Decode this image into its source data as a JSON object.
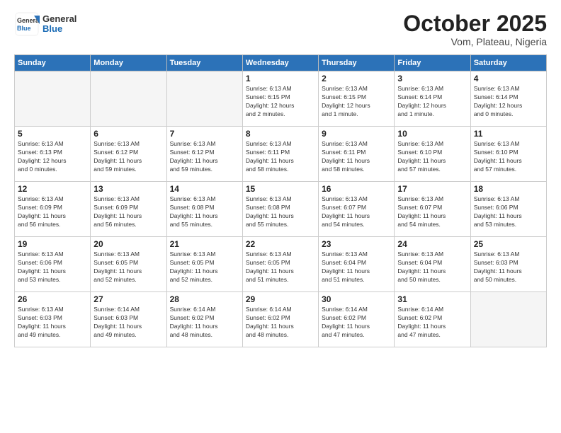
{
  "logo": {
    "text_general": "General",
    "text_blue": "Blue"
  },
  "header": {
    "month": "October 2025",
    "location": "Vom, Plateau, Nigeria"
  },
  "weekdays": [
    "Sunday",
    "Monday",
    "Tuesday",
    "Wednesday",
    "Thursday",
    "Friday",
    "Saturday"
  ],
  "weeks": [
    [
      {
        "day": "",
        "info": ""
      },
      {
        "day": "",
        "info": ""
      },
      {
        "day": "",
        "info": ""
      },
      {
        "day": "1",
        "info": "Sunrise: 6:13 AM\nSunset: 6:15 PM\nDaylight: 12 hours\nand 2 minutes."
      },
      {
        "day": "2",
        "info": "Sunrise: 6:13 AM\nSunset: 6:15 PM\nDaylight: 12 hours\nand 1 minute."
      },
      {
        "day": "3",
        "info": "Sunrise: 6:13 AM\nSunset: 6:14 PM\nDaylight: 12 hours\nand 1 minute."
      },
      {
        "day": "4",
        "info": "Sunrise: 6:13 AM\nSunset: 6:14 PM\nDaylight: 12 hours\nand 0 minutes."
      }
    ],
    [
      {
        "day": "5",
        "info": "Sunrise: 6:13 AM\nSunset: 6:13 PM\nDaylight: 12 hours\nand 0 minutes."
      },
      {
        "day": "6",
        "info": "Sunrise: 6:13 AM\nSunset: 6:12 PM\nDaylight: 11 hours\nand 59 minutes."
      },
      {
        "day": "7",
        "info": "Sunrise: 6:13 AM\nSunset: 6:12 PM\nDaylight: 11 hours\nand 59 minutes."
      },
      {
        "day": "8",
        "info": "Sunrise: 6:13 AM\nSunset: 6:11 PM\nDaylight: 11 hours\nand 58 minutes."
      },
      {
        "day": "9",
        "info": "Sunrise: 6:13 AM\nSunset: 6:11 PM\nDaylight: 11 hours\nand 58 minutes."
      },
      {
        "day": "10",
        "info": "Sunrise: 6:13 AM\nSunset: 6:10 PM\nDaylight: 11 hours\nand 57 minutes."
      },
      {
        "day": "11",
        "info": "Sunrise: 6:13 AM\nSunset: 6:10 PM\nDaylight: 11 hours\nand 57 minutes."
      }
    ],
    [
      {
        "day": "12",
        "info": "Sunrise: 6:13 AM\nSunset: 6:09 PM\nDaylight: 11 hours\nand 56 minutes."
      },
      {
        "day": "13",
        "info": "Sunrise: 6:13 AM\nSunset: 6:09 PM\nDaylight: 11 hours\nand 56 minutes."
      },
      {
        "day": "14",
        "info": "Sunrise: 6:13 AM\nSunset: 6:08 PM\nDaylight: 11 hours\nand 55 minutes."
      },
      {
        "day": "15",
        "info": "Sunrise: 6:13 AM\nSunset: 6:08 PM\nDaylight: 11 hours\nand 55 minutes."
      },
      {
        "day": "16",
        "info": "Sunrise: 6:13 AM\nSunset: 6:07 PM\nDaylight: 11 hours\nand 54 minutes."
      },
      {
        "day": "17",
        "info": "Sunrise: 6:13 AM\nSunset: 6:07 PM\nDaylight: 11 hours\nand 54 minutes."
      },
      {
        "day": "18",
        "info": "Sunrise: 6:13 AM\nSunset: 6:06 PM\nDaylight: 11 hours\nand 53 minutes."
      }
    ],
    [
      {
        "day": "19",
        "info": "Sunrise: 6:13 AM\nSunset: 6:06 PM\nDaylight: 11 hours\nand 53 minutes."
      },
      {
        "day": "20",
        "info": "Sunrise: 6:13 AM\nSunset: 6:05 PM\nDaylight: 11 hours\nand 52 minutes."
      },
      {
        "day": "21",
        "info": "Sunrise: 6:13 AM\nSunset: 6:05 PM\nDaylight: 11 hours\nand 52 minutes."
      },
      {
        "day": "22",
        "info": "Sunrise: 6:13 AM\nSunset: 6:05 PM\nDaylight: 11 hours\nand 51 minutes."
      },
      {
        "day": "23",
        "info": "Sunrise: 6:13 AM\nSunset: 6:04 PM\nDaylight: 11 hours\nand 51 minutes."
      },
      {
        "day": "24",
        "info": "Sunrise: 6:13 AM\nSunset: 6:04 PM\nDaylight: 11 hours\nand 50 minutes."
      },
      {
        "day": "25",
        "info": "Sunrise: 6:13 AM\nSunset: 6:03 PM\nDaylight: 11 hours\nand 50 minutes."
      }
    ],
    [
      {
        "day": "26",
        "info": "Sunrise: 6:13 AM\nSunset: 6:03 PM\nDaylight: 11 hours\nand 49 minutes."
      },
      {
        "day": "27",
        "info": "Sunrise: 6:14 AM\nSunset: 6:03 PM\nDaylight: 11 hours\nand 49 minutes."
      },
      {
        "day": "28",
        "info": "Sunrise: 6:14 AM\nSunset: 6:02 PM\nDaylight: 11 hours\nand 48 minutes."
      },
      {
        "day": "29",
        "info": "Sunrise: 6:14 AM\nSunset: 6:02 PM\nDaylight: 11 hours\nand 48 minutes."
      },
      {
        "day": "30",
        "info": "Sunrise: 6:14 AM\nSunset: 6:02 PM\nDaylight: 11 hours\nand 47 minutes."
      },
      {
        "day": "31",
        "info": "Sunrise: 6:14 AM\nSunset: 6:02 PM\nDaylight: 11 hours\nand 47 minutes."
      },
      {
        "day": "",
        "info": ""
      }
    ]
  ]
}
